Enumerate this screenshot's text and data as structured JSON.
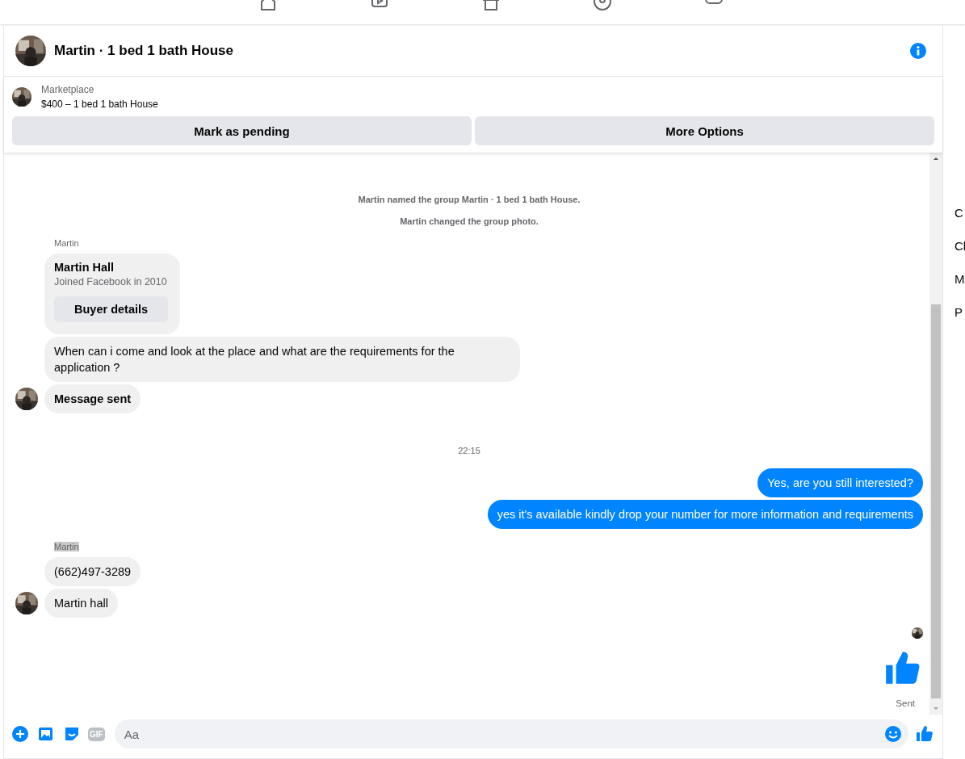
{
  "top_nav": {
    "items": [
      {
        "kind": "home"
      },
      {
        "kind": "video"
      },
      {
        "kind": "store"
      },
      {
        "kind": "people"
      },
      {
        "kind": "games"
      }
    ]
  },
  "chat": {
    "title": "Martin · 1 bed 1 bath House",
    "listing": {
      "source": "Marketplace",
      "title": "$400 – 1 bed 1 bath House"
    },
    "actions": [
      "Mark as pending",
      "More Options"
    ],
    "messages": [
      {
        "kind": "event",
        "text": "Martin named the group Martin · 1 bed 1 bath House."
      },
      {
        "kind": "event",
        "text": "Martin changed the group photo."
      },
      {
        "kind": "group",
        "outgoing": false,
        "sender": "Martin",
        "sender_highlighted": false,
        "items": [
          {
            "kind": "card",
            "name": "Martin Hall",
            "subtitle": "Joined Facebook in 2010",
            "button": "Buyer details"
          },
          {
            "kind": "text",
            "text": "When can i come and look at the place and what are the requirements for the application ?",
            "bold": false
          },
          {
            "kind": "text",
            "text": "Message sent",
            "bold": true
          }
        ]
      },
      {
        "kind": "time",
        "text": "22:15"
      },
      {
        "kind": "group",
        "outgoing": true,
        "items": [
          {
            "kind": "text",
            "text": "Yes, are you still interested?",
            "bold": false
          },
          {
            "kind": "text",
            "text": "yes it's available kindly drop your number for more information and requirements",
            "bold": false
          }
        ]
      },
      {
        "kind": "group",
        "outgoing": false,
        "sender": "Martin",
        "sender_highlighted": true,
        "items": [
          {
            "kind": "text",
            "text": "(662)497-3289",
            "bold": false
          },
          {
            "kind": "text",
            "text": "Martin hall",
            "bold": false
          }
        ]
      },
      {
        "kind": "like",
        "status": "Sent"
      }
    ],
    "composer": {
      "gif_label": "GIF",
      "placeholder": "Aa"
    }
  },
  "side_menu": [
    "C",
    "Cl",
    "M",
    "P"
  ]
}
